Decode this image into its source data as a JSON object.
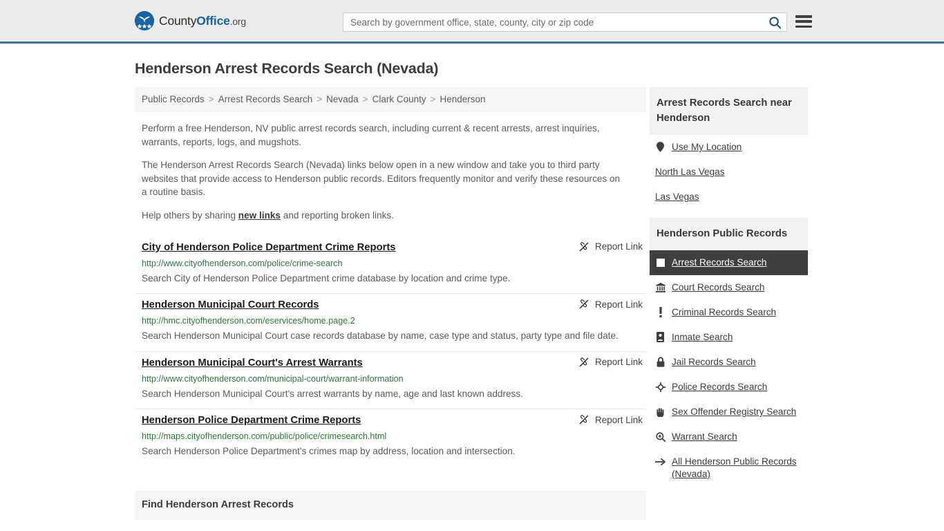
{
  "header": {
    "brand": {
      "part1": "County",
      "part2": "Office",
      "part3": ".org",
      "logo_icon": "eagle-stars-logo"
    },
    "search": {
      "placeholder": "Search by government office, state, county, city or zip code",
      "value": "",
      "icon": "search-icon"
    },
    "menu_icon": "hamburger-menu-icon",
    "accent_color": "#1763a8",
    "border_color": "#3b72a8"
  },
  "main": {
    "title": "Henderson Arrest Records Search (Nevada)",
    "breadcrumb": [
      "Public Records",
      "Arrest Records Search",
      "Nevada",
      "Clark County",
      "Henderson"
    ],
    "breadcrumb_separator": ">",
    "intro": [
      "Perform a free Henderson, NV public arrest records search, including current & recent arrests, arrest inquiries, warrants, reports, logs, and mugshots.",
      "The Henderson Arrest Records Search (Nevada) links below open in a new window and take you to third party websites that provide access to Henderson public records. Editors frequently monitor and verify these resources on a routine basis."
    ],
    "help_prefix": "Help others by sharing ",
    "help_link": "new links",
    "help_suffix": " and reporting broken links.",
    "report_link_label": "Report Link",
    "report_link_icon": "broken-link-icon",
    "url_color": "#2a7a37",
    "results": [
      {
        "title": "City of Henderson Police Department Crime Reports",
        "url": "http://www.cityofhenderson.com/police/crime-search",
        "description": "Search City of Henderson Police Department crime database by location and crime type."
      },
      {
        "title": "Henderson Municipal Court Records",
        "url": "http://hmc.cityofhenderson.com/eservices/home.page.2",
        "description": "Search Henderson Municipal Court case records database by name, case type and status, party type and file date."
      },
      {
        "title": "Henderson Municipal Court's Arrest Warrants",
        "url": "http://www.cityofhenderson.com/municipal-court/warrant-information",
        "description": "Search Henderson Municipal Court's arrest warrants by name, age and last known address."
      },
      {
        "title": "Henderson Police Department Crime Reports",
        "url": "http://maps.cityofhenderson.com/public/police/crimesearch.html",
        "description": "Search Henderson Police Department's crimes map by address, location and intersection."
      }
    ],
    "find_box_title": "Find Henderson Arrest Records"
  },
  "sidebar": {
    "near_panel": {
      "heading": "Arrest Records Search near Henderson",
      "items": [
        {
          "label": "Use My Location",
          "icon": "map-pin-icon",
          "has_icon": true
        },
        {
          "label": "North Las Vegas",
          "icon": "",
          "has_icon": false
        },
        {
          "label": "Las Vegas",
          "icon": "",
          "has_icon": false
        }
      ]
    },
    "records_panel": {
      "heading": "Henderson Public Records",
      "items": [
        {
          "label": "Arrest Records Search",
          "icon": "square-icon",
          "active": true
        },
        {
          "label": "Court Records Search",
          "icon": "courthouse-icon",
          "active": false
        },
        {
          "label": "Criminal Records Search",
          "icon": "exclamation-icon",
          "active": false
        },
        {
          "label": "Inmate Search",
          "icon": "id-badge-icon",
          "active": false
        },
        {
          "label": "Jail Records Search",
          "icon": "lock-icon",
          "active": false
        },
        {
          "label": "Police Records Search",
          "icon": "police-badge-icon",
          "active": false
        },
        {
          "label": "Sex Offender Registry Search",
          "icon": "hand-icon",
          "active": false
        },
        {
          "label": "Warrant Search",
          "icon": "magnifier-plus-icon",
          "active": false
        },
        {
          "label": "All Henderson Public Records (Nevada)",
          "icon": "arrow-right-icon",
          "active": false
        }
      ],
      "active_bg": "#3f3f3f"
    }
  }
}
